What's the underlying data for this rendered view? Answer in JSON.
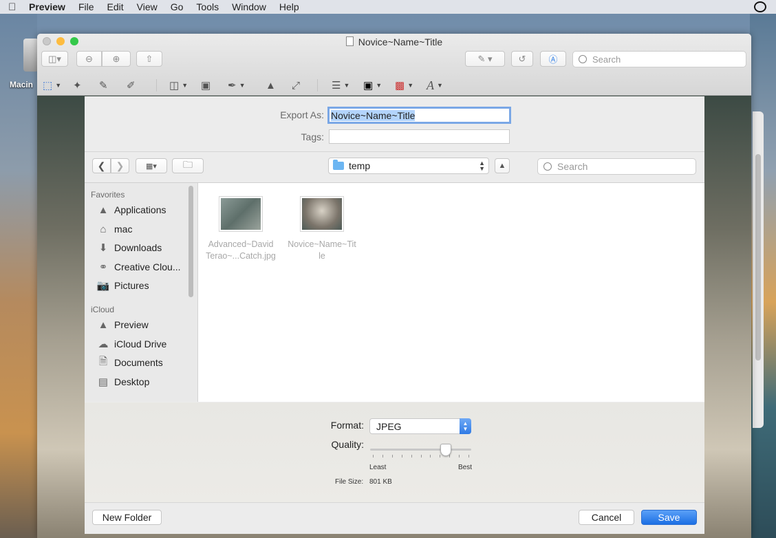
{
  "menubar": {
    "app_name": "Preview",
    "items": [
      "File",
      "Edit",
      "View",
      "Go",
      "Tools",
      "Window",
      "Help"
    ]
  },
  "desktop": {
    "drive_label": "Macin"
  },
  "window": {
    "title": "Novice~Name~Title",
    "search_placeholder": "Search"
  },
  "sheet": {
    "export_as_label": "Export As:",
    "export_as_value": "Novice~Name~Title",
    "tags_label": "Tags:",
    "tags_value": "",
    "location": "temp",
    "search_placeholder": "Search"
  },
  "sidebar": {
    "sections": [
      {
        "title": "Favorites",
        "items": [
          {
            "label": "Applications",
            "icon": "applications-icon"
          },
          {
            "label": "mac",
            "icon": "home-icon"
          },
          {
            "label": "Downloads",
            "icon": "downloads-icon"
          },
          {
            "label": "Creative Clou...",
            "icon": "creative-cloud-icon"
          },
          {
            "label": "Pictures",
            "icon": "pictures-icon"
          }
        ]
      },
      {
        "title": "iCloud",
        "items": [
          {
            "label": "Preview",
            "icon": "preview-app-icon"
          },
          {
            "label": "iCloud Drive",
            "icon": "cloud-icon"
          },
          {
            "label": "Documents",
            "icon": "documents-icon"
          },
          {
            "label": "Desktop",
            "icon": "desktop-icon"
          }
        ]
      }
    ]
  },
  "files": [
    {
      "line1": "Advanced~David",
      "line2": "Terao~...Catch.jpg"
    },
    {
      "line1": "Novice~Name~Tit",
      "line2": "le"
    }
  ],
  "options": {
    "format_label": "Format:",
    "format_value": "JPEG",
    "quality_label": "Quality:",
    "quality_fraction": 0.78,
    "quality_min_label": "Least",
    "quality_max_label": "Best",
    "file_size_label": "File Size:",
    "file_size_value": "801 KB"
  },
  "footer": {
    "new_folder": "New Folder",
    "cancel": "Cancel",
    "save": "Save"
  },
  "colors": {
    "accent": "#1c6fe4",
    "selection": "#b3d4fc"
  }
}
